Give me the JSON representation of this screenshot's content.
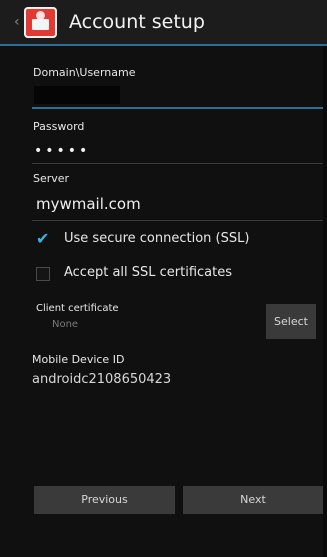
{
  "header": {
    "title": "Account setup",
    "back_glyph": "‹",
    "app_icon": "mail-app-icon",
    "accent_color": "#2b6f94"
  },
  "form": {
    "username_label": "Domain\\Username",
    "password_label": "Password",
    "password_mask": "•••••",
    "server_label": "Server",
    "server_value": "mywmail.com",
    "ssl_label": "Use secure connection (SSL)",
    "ssl_checked": true,
    "accept_all_label": "Accept all SSL certificates",
    "accept_all_checked": false,
    "client_cert_label": "Client certificate",
    "client_cert_value": "None",
    "select_label": "Select",
    "device_id_label": "Mobile Device ID",
    "device_id_value": "androidc2108650423"
  },
  "footer": {
    "previous_label": "Previous",
    "next_label": "Next"
  }
}
